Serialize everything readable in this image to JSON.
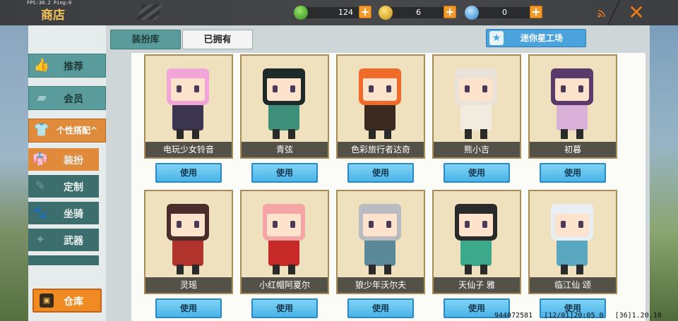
{
  "hud": {
    "fps_text": "FPS:30.2  Ping:0",
    "title": "商店",
    "currencies": [
      {
        "icon": "green-gem-icon",
        "amount": "124",
        "color": "#4caf3a"
      },
      {
        "icon": "gold-coin-icon",
        "amount": "6",
        "color": "#e3b424"
      },
      {
        "icon": "mini-coin-icon",
        "amount": "0",
        "color": "#3fa3e0"
      }
    ],
    "plus_label": "+",
    "close_label": "✕"
  },
  "tabs": {
    "wardrobe": "装扮库",
    "owned": "已拥有",
    "star_workshop": "迷你星工场"
  },
  "sidebar": {
    "recommend": "推荐",
    "member": "会员",
    "personal": "个性搭配^",
    "dress_up": "装扮",
    "custom": "定制",
    "mount": "坐骑",
    "weapon": "武器",
    "warehouse": "仓库"
  },
  "cards": [
    {
      "name": "电玩少女铃音",
      "hair": "#f2a6d8",
      "outfit": "#3b3550"
    },
    {
      "name": "青弦",
      "hair": "#1e2a2a",
      "outfit": "#3d8f7a"
    },
    {
      "name": "色彩旅行者达奇",
      "hair": "#f06a2a",
      "outfit": "#3a2a20"
    },
    {
      "name": "熊小吉",
      "hair": "#e8e2d8",
      "outfit": "#f2ece0"
    },
    {
      "name": "初暮",
      "hair": "#5a3a6a",
      "outfit": "#d9b0d8"
    },
    {
      "name": "灵瑶",
      "hair": "#4a2c2a",
      "outfit": "#b0342c"
    },
    {
      "name": "小红帽阿夏尔",
      "hair": "#f5a5a5",
      "outfit": "#c82a2a"
    },
    {
      "name": "狼少年沃尔夫",
      "hair": "#b8bcc0",
      "outfit": "#5a8a9a"
    },
    {
      "name": "天仙子 雅",
      "hair": "#2a2a2a",
      "outfit": "#3caa8a"
    },
    {
      "name": "临江仙 颂",
      "hair": "#e8eef2",
      "outfit": "#5aa8c0"
    }
  ],
  "use_label": "使用",
  "footer": {
    "id": "944072581",
    "time": "[12/01]20:05 0",
    "version": "[36]1.20.10"
  }
}
